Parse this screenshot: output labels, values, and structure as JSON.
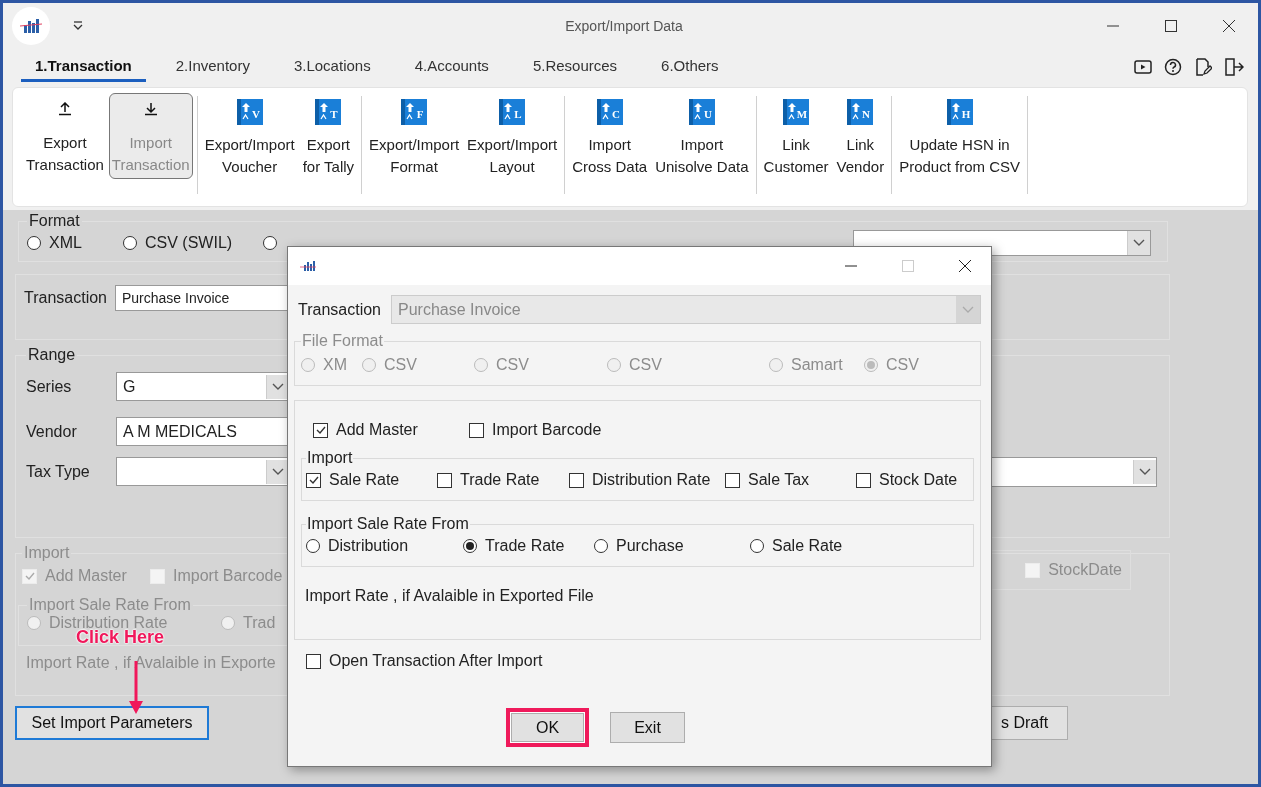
{
  "window": {
    "title": "Export/Import Data"
  },
  "tabs": [
    {
      "label": "1.Transaction",
      "selected": true
    },
    {
      "label": "2.Inventory",
      "selected": false
    },
    {
      "label": "3.Locations",
      "selected": false
    },
    {
      "label": "4.Accounts",
      "selected": false
    },
    {
      "label": "5.Resources",
      "selected": false
    },
    {
      "label": "6.Others",
      "selected": false
    }
  ],
  "ribbon": {
    "groups": [
      [
        {
          "label": "Export\nTransaction",
          "kind": "upload",
          "selected": false
        },
        {
          "label": "Import\nTransaction",
          "kind": "download",
          "selected": true
        }
      ],
      [
        {
          "label": "Export/Import\nVoucher",
          "kind": "book",
          "icon_letter": "V",
          "selected": false
        },
        {
          "label": "Export\nfor Tally",
          "kind": "book",
          "icon_letter": "T",
          "selected": false
        }
      ],
      [
        {
          "label": "Export/Import\nFormat",
          "kind": "book",
          "icon_letter": "F",
          "selected": false
        },
        {
          "label": "Export/Import\nLayout",
          "kind": "book",
          "icon_letter": "L",
          "selected": false
        }
      ],
      [
        {
          "label": "Import\nCross Data",
          "kind": "book",
          "icon_letter": "C",
          "selected": false
        },
        {
          "label": "Import\nUnisolve Data",
          "kind": "book",
          "icon_letter": "U",
          "selected": false
        }
      ],
      [
        {
          "label": "Link\nCustomer",
          "kind": "book",
          "icon_letter": "M",
          "selected": false
        },
        {
          "label": "Link\nVendor",
          "kind": "book",
          "icon_letter": "N",
          "selected": false
        }
      ],
      [
        {
          "label": "Update HSN in\nProduct from CSV",
          "kind": "book",
          "icon_letter": "H",
          "selected": false
        }
      ]
    ]
  },
  "form": {
    "format": {
      "legend": "Format",
      "options": [
        {
          "label": "XML",
          "selected": false
        },
        {
          "label": "CSV (SWIL)",
          "selected": false
        },
        {
          "selected": false
        }
      ]
    },
    "transaction": {
      "label": "Transaction",
      "value": "Purchase Invoice"
    },
    "range": {
      "legend": "Range",
      "fields": [
        {
          "label": "Series",
          "value": "G",
          "kind": "combo"
        },
        {
          "label": "Vendor",
          "value": "A M MEDICALS",
          "kind": "text"
        },
        {
          "label": "Tax Type",
          "kind": "combo"
        }
      ]
    },
    "import": {
      "legend": "Import",
      "checks": [
        {
          "label": "Add Master",
          "checked": true
        },
        {
          "label": "Import Barcode",
          "checked": false
        }
      ],
      "sale_rate_from": {
        "legend": "Import Sale Rate From",
        "options": [
          {
            "label": "Distribution Rate",
            "selected": false
          },
          {
            "label": "Trad",
            "selected": false
          }
        ]
      },
      "note": "Import Rate , if Avalaible in Exporte",
      "stock_date": {
        "label": "StockDate",
        "checked": false
      }
    },
    "buttons": [
      {
        "label": "Set Import Parameters",
        "focused": true
      },
      {
        "label": "s Draft",
        "focused": false
      }
    ]
  },
  "dialog": {
    "transaction": {
      "label": "Transaction",
      "value": "Purchase Invoice"
    },
    "file_format": {
      "legend": "File Format",
      "options": [
        {
          "label": "XM",
          "selected": false
        },
        {
          "label": "CSV",
          "selected": false
        },
        {
          "label": "CSV",
          "selected": false
        },
        {
          "label": "CSV",
          "selected": false
        },
        {
          "label": "Samart",
          "selected": false
        },
        {
          "label": "CSV",
          "selected": true
        }
      ]
    },
    "checks": [
      {
        "label": "Add Master",
        "checked": true
      },
      {
        "label": "Import Barcode",
        "checked": false
      }
    ],
    "import": {
      "legend": "Import",
      "checks": [
        {
          "label": "Sale Rate",
          "checked": true
        },
        {
          "label": "Trade Rate",
          "checked": false
        },
        {
          "label": "Distribution Rate",
          "checked": false
        },
        {
          "label": "Sale Tax",
          "checked": false
        },
        {
          "label": "Stock Date",
          "checked": false
        }
      ]
    },
    "sale_rate_from": {
      "legend": "Import Sale Rate From",
      "options": [
        {
          "label": "Distribution",
          "selected": false
        },
        {
          "label": "Trade Rate",
          "selected": true
        },
        {
          "label": "Purchase",
          "selected": false
        },
        {
          "label": "Sale Rate",
          "selected": false
        }
      ]
    },
    "note": "Import Rate , if Avalaible in Exported File",
    "open_after": {
      "label": "Open Transaction After Import",
      "checked": false
    },
    "buttons": [
      {
        "label": "OK",
        "highlighted": true
      },
      {
        "label": "Exit",
        "highlighted": false
      }
    ]
  },
  "annotation": {
    "text": "Click Here"
  }
}
